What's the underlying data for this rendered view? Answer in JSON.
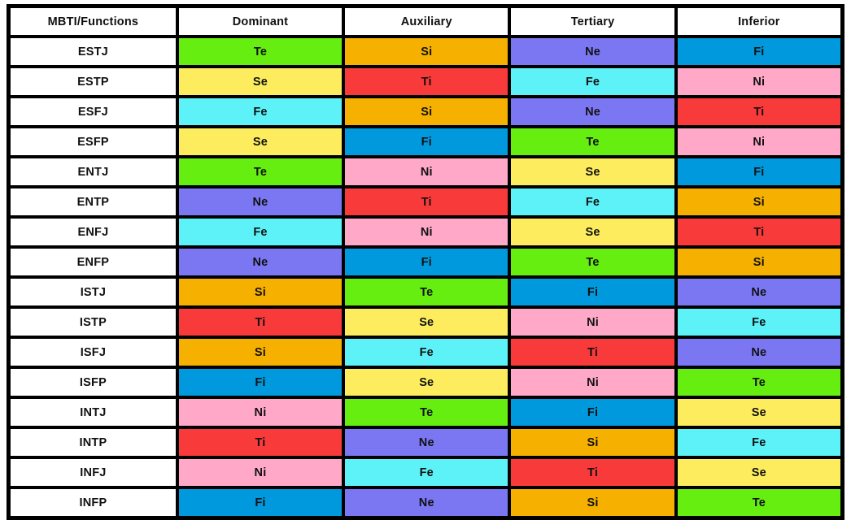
{
  "table": {
    "headers": [
      "MBTI/Functions",
      "Dominant",
      "Auxiliary",
      "Tertiary",
      "Inferior"
    ],
    "rows": [
      {
        "type": "ESTJ",
        "dominant": "Te",
        "auxiliary": "Si",
        "tertiary": "Ne",
        "inferior": "Fi"
      },
      {
        "type": "ESTP",
        "dominant": "Se",
        "auxiliary": "Ti",
        "tertiary": "Fe",
        "inferior": "Ni"
      },
      {
        "type": "ESFJ",
        "dominant": "Fe",
        "auxiliary": "Si",
        "tertiary": "Ne",
        "inferior": "Ti"
      },
      {
        "type": "ESFP",
        "dominant": "Se",
        "auxiliary": "Fi",
        "tertiary": "Te",
        "inferior": "Ni"
      },
      {
        "type": "ENTJ",
        "dominant": "Te",
        "auxiliary": "Ni",
        "tertiary": "Se",
        "inferior": "Fi"
      },
      {
        "type": "ENTP",
        "dominant": "Ne",
        "auxiliary": "Ti",
        "tertiary": "Fe",
        "inferior": "Si"
      },
      {
        "type": "ENFJ",
        "dominant": "Fe",
        "auxiliary": "Ni",
        "tertiary": "Se",
        "inferior": "Ti"
      },
      {
        "type": "ENFP",
        "dominant": "Ne",
        "auxiliary": "Fi",
        "tertiary": "Te",
        "inferior": "Si"
      },
      {
        "type": "ISTJ",
        "dominant": "Si",
        "auxiliary": "Te",
        "tertiary": "Fi",
        "inferior": "Ne"
      },
      {
        "type": "ISTP",
        "dominant": "Ti",
        "auxiliary": "Se",
        "tertiary": "Ni",
        "inferior": "Fe"
      },
      {
        "type": "ISFJ",
        "dominant": "Si",
        "auxiliary": "Fe",
        "tertiary": "Ti",
        "inferior": "Ne"
      },
      {
        "type": "ISFP",
        "dominant": "Fi",
        "auxiliary": "Se",
        "tertiary": "Ni",
        "inferior": "Te"
      },
      {
        "type": "INTJ",
        "dominant": "Ni",
        "auxiliary": "Te",
        "tertiary": "Fi",
        "inferior": "Se"
      },
      {
        "type": "INTP",
        "dominant": "Ti",
        "auxiliary": "Ne",
        "tertiary": "Si",
        "inferior": "Fe"
      },
      {
        "type": "INFJ",
        "dominant": "Ni",
        "auxiliary": "Fe",
        "tertiary": "Ti",
        "inferior": "Se"
      },
      {
        "type": "INFP",
        "dominant": "Fi",
        "auxiliary": "Ne",
        "tertiary": "Si",
        "inferior": "Te"
      }
    ]
  },
  "function_colors": {
    "Te": "#66EE11",
    "Ti": "#F93A3A",
    "Fe": "#5DF2F8",
    "Fi": "#0099DD",
    "Se": "#FCEC5E",
    "Si": "#F5B000",
    "Ne": "#7B77F2",
    "Ni": "#FFA8C8"
  },
  "style": {
    "border_color": "#000000",
    "header_bg": "#FFFFFF",
    "type_bg": "#FFFFFF",
    "text_color": "#111111"
  }
}
